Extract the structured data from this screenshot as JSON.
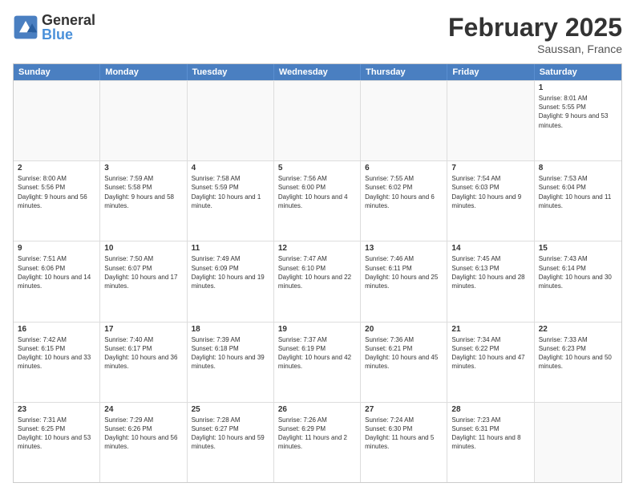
{
  "logo": {
    "general": "General",
    "blue": "Blue"
  },
  "header": {
    "month": "February 2025",
    "location": "Saussan, France"
  },
  "weekdays": [
    "Sunday",
    "Monday",
    "Tuesday",
    "Wednesday",
    "Thursday",
    "Friday",
    "Saturday"
  ],
  "rows": [
    [
      {
        "day": "",
        "info": ""
      },
      {
        "day": "",
        "info": ""
      },
      {
        "day": "",
        "info": ""
      },
      {
        "day": "",
        "info": ""
      },
      {
        "day": "",
        "info": ""
      },
      {
        "day": "",
        "info": ""
      },
      {
        "day": "1",
        "info": "Sunrise: 8:01 AM\nSunset: 5:55 PM\nDaylight: 9 hours and 53 minutes."
      }
    ],
    [
      {
        "day": "2",
        "info": "Sunrise: 8:00 AM\nSunset: 5:56 PM\nDaylight: 9 hours and 56 minutes."
      },
      {
        "day": "3",
        "info": "Sunrise: 7:59 AM\nSunset: 5:58 PM\nDaylight: 9 hours and 58 minutes."
      },
      {
        "day": "4",
        "info": "Sunrise: 7:58 AM\nSunset: 5:59 PM\nDaylight: 10 hours and 1 minute."
      },
      {
        "day": "5",
        "info": "Sunrise: 7:56 AM\nSunset: 6:00 PM\nDaylight: 10 hours and 4 minutes."
      },
      {
        "day": "6",
        "info": "Sunrise: 7:55 AM\nSunset: 6:02 PM\nDaylight: 10 hours and 6 minutes."
      },
      {
        "day": "7",
        "info": "Sunrise: 7:54 AM\nSunset: 6:03 PM\nDaylight: 10 hours and 9 minutes."
      },
      {
        "day": "8",
        "info": "Sunrise: 7:53 AM\nSunset: 6:04 PM\nDaylight: 10 hours and 11 minutes."
      }
    ],
    [
      {
        "day": "9",
        "info": "Sunrise: 7:51 AM\nSunset: 6:06 PM\nDaylight: 10 hours and 14 minutes."
      },
      {
        "day": "10",
        "info": "Sunrise: 7:50 AM\nSunset: 6:07 PM\nDaylight: 10 hours and 17 minutes."
      },
      {
        "day": "11",
        "info": "Sunrise: 7:49 AM\nSunset: 6:09 PM\nDaylight: 10 hours and 19 minutes."
      },
      {
        "day": "12",
        "info": "Sunrise: 7:47 AM\nSunset: 6:10 PM\nDaylight: 10 hours and 22 minutes."
      },
      {
        "day": "13",
        "info": "Sunrise: 7:46 AM\nSunset: 6:11 PM\nDaylight: 10 hours and 25 minutes."
      },
      {
        "day": "14",
        "info": "Sunrise: 7:45 AM\nSunset: 6:13 PM\nDaylight: 10 hours and 28 minutes."
      },
      {
        "day": "15",
        "info": "Sunrise: 7:43 AM\nSunset: 6:14 PM\nDaylight: 10 hours and 30 minutes."
      }
    ],
    [
      {
        "day": "16",
        "info": "Sunrise: 7:42 AM\nSunset: 6:15 PM\nDaylight: 10 hours and 33 minutes."
      },
      {
        "day": "17",
        "info": "Sunrise: 7:40 AM\nSunset: 6:17 PM\nDaylight: 10 hours and 36 minutes."
      },
      {
        "day": "18",
        "info": "Sunrise: 7:39 AM\nSunset: 6:18 PM\nDaylight: 10 hours and 39 minutes."
      },
      {
        "day": "19",
        "info": "Sunrise: 7:37 AM\nSunset: 6:19 PM\nDaylight: 10 hours and 42 minutes."
      },
      {
        "day": "20",
        "info": "Sunrise: 7:36 AM\nSunset: 6:21 PM\nDaylight: 10 hours and 45 minutes."
      },
      {
        "day": "21",
        "info": "Sunrise: 7:34 AM\nSunset: 6:22 PM\nDaylight: 10 hours and 47 minutes."
      },
      {
        "day": "22",
        "info": "Sunrise: 7:33 AM\nSunset: 6:23 PM\nDaylight: 10 hours and 50 minutes."
      }
    ],
    [
      {
        "day": "23",
        "info": "Sunrise: 7:31 AM\nSunset: 6:25 PM\nDaylight: 10 hours and 53 minutes."
      },
      {
        "day": "24",
        "info": "Sunrise: 7:29 AM\nSunset: 6:26 PM\nDaylight: 10 hours and 56 minutes."
      },
      {
        "day": "25",
        "info": "Sunrise: 7:28 AM\nSunset: 6:27 PM\nDaylight: 10 hours and 59 minutes."
      },
      {
        "day": "26",
        "info": "Sunrise: 7:26 AM\nSunset: 6:29 PM\nDaylight: 11 hours and 2 minutes."
      },
      {
        "day": "27",
        "info": "Sunrise: 7:24 AM\nSunset: 6:30 PM\nDaylight: 11 hours and 5 minutes."
      },
      {
        "day": "28",
        "info": "Sunrise: 7:23 AM\nSunset: 6:31 PM\nDaylight: 11 hours and 8 minutes."
      },
      {
        "day": "",
        "info": ""
      }
    ]
  ]
}
